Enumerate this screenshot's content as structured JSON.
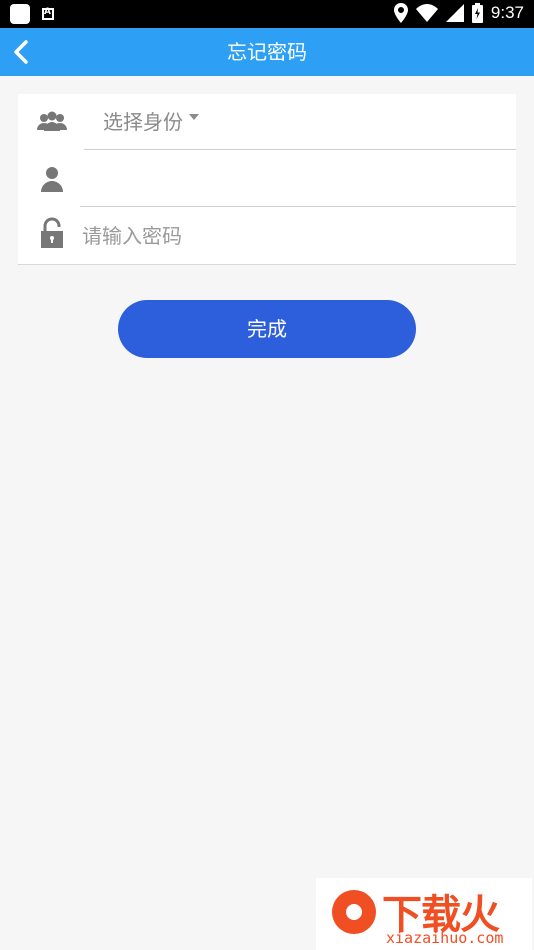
{
  "status_bar": {
    "time": "9:37"
  },
  "header": {
    "title": "忘记密码"
  },
  "form": {
    "identity_select": {
      "selected": "选择身份"
    },
    "username_input": {
      "value": "",
      "placeholder": ""
    },
    "password_input": {
      "value": "",
      "placeholder": "请输入密码"
    }
  },
  "actions": {
    "done_label": "完成"
  },
  "watermark": {
    "title": "下载火",
    "subtitle": "xiazaihuo.com"
  },
  "colors": {
    "header_bg": "#2d9ff5",
    "button_bg": "#2d5fdc",
    "page_bg": "#f6f6f6",
    "watermark": "#f04e23"
  }
}
